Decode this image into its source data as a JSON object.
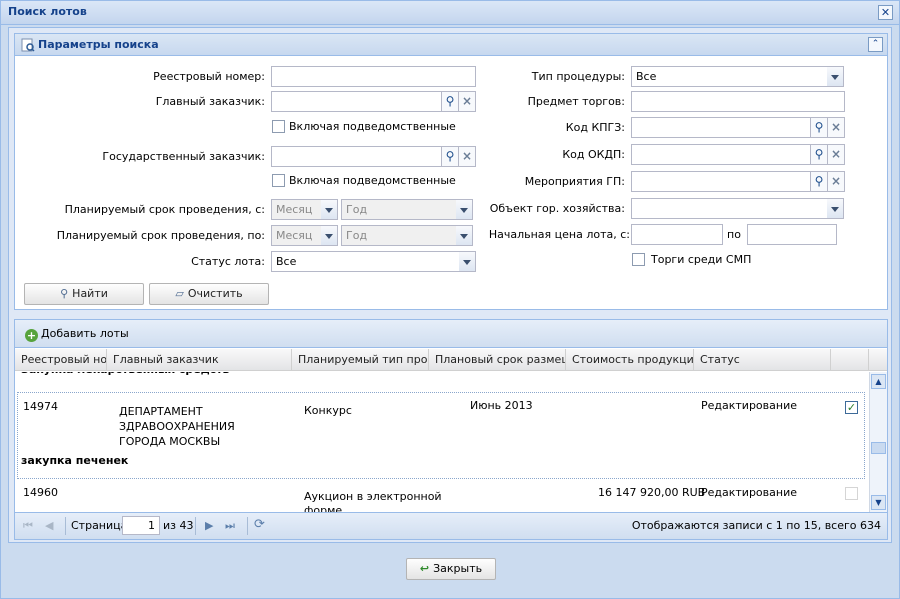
{
  "window": {
    "title": "Поиск лотов",
    "close_glyph": "✕"
  },
  "search_panel": {
    "title": "Параметры поиска",
    "collapse_glyph": "⌃",
    "registry_number": {
      "label": "Реестровый номер:",
      "value": ""
    },
    "main_customer": {
      "label": "Главный заказчик:",
      "value": ""
    },
    "include_subordinate_1": {
      "label": "Включая подведомственные",
      "checked": false
    },
    "state_customer": {
      "label": "Государственный заказчик:",
      "value": ""
    },
    "include_subordinate_2": {
      "label": "Включая подведомственные",
      "checked": false
    },
    "planned_from": {
      "label": "Планируемый срок проведения, с:",
      "month_placeholder": "Месяц",
      "year_placeholder": "Год"
    },
    "planned_to": {
      "label": "Планируемый срок проведения, по:",
      "month_placeholder": "Месяц",
      "year_placeholder": "Год"
    },
    "lot_status": {
      "label": "Статус лота:",
      "value": "Все"
    },
    "procedure_type": {
      "label": "Тип процедуры:",
      "value": "Все"
    },
    "subject": {
      "label": "Предмет торгов:",
      "value": ""
    },
    "kpgz": {
      "label": "Код КПГЗ:",
      "value": ""
    },
    "okdp": {
      "label": "Код ОКДП:",
      "value": ""
    },
    "gp_events": {
      "label": "Мероприятия ГП:",
      "value": ""
    },
    "city_object": {
      "label": "Объект гор. хозяйства:",
      "value": ""
    },
    "start_price": {
      "label": "Начальная цена лота, с:",
      "to_label": "по",
      "from": "",
      "to": ""
    },
    "smp_only": {
      "label": "Торги среди СМП",
      "checked": false
    },
    "find_button": "Найти",
    "clear_button": "Очистить"
  },
  "grid": {
    "add_button": "Добавить лоты",
    "columns": [
      "Реестровый ном...",
      "Главный заказчик",
      "Планируемый тип проц...",
      "Плановый срок размещ...",
      "Стоимость продукции",
      "Статус"
    ],
    "partial_group_label": "Закупка лекарственных средств",
    "rows": [
      {
        "registry": "14974",
        "customer": "ДЕПАРТАМЕНТ\nЗДРАВООХРАНЕНИЯ\nГОРОДА МОСКВЫ",
        "proc_type": "Конкурс",
        "planned": "Июнь 2013",
        "cost": "",
        "status": "Редактирование",
        "subject": "закупка печенек",
        "selected": true
      },
      {
        "registry": "14960",
        "customer": "",
        "proc_type": "Аукцион в электронной\nформе",
        "planned": "",
        "cost": "16 147 920,00 RUB",
        "status": "Редактирование",
        "selected": false
      }
    ]
  },
  "pager": {
    "page_label": "Страница",
    "page_value": "1",
    "of_label": "из 43",
    "summary": "Отображаются записи с 1 по 15, всего 634"
  },
  "footer": {
    "close_button": "Закрыть"
  }
}
